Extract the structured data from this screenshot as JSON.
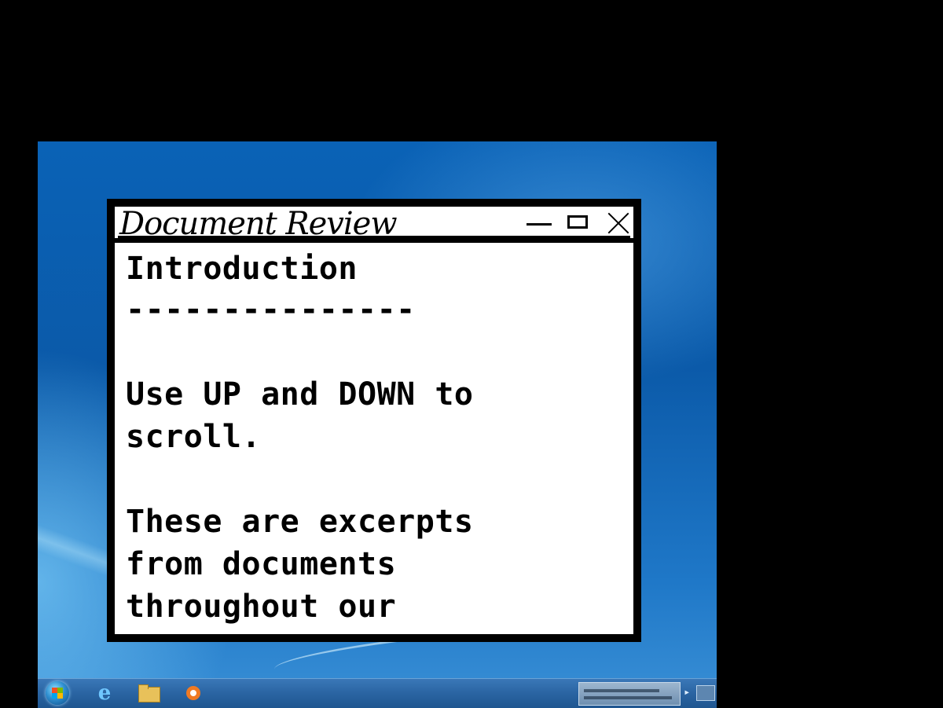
{
  "window": {
    "title": "Document Review",
    "controls": {
      "minimize_icon": "minimize-icon",
      "maximize_icon": "maximize-icon",
      "close_icon": "close-icon"
    }
  },
  "document": {
    "lines": [
      "Introduction",
      "---------------",
      "",
      "Use UP and DOWN to",
      "scroll.",
      "",
      "These are excerpts",
      "from documents",
      "throughout our"
    ]
  },
  "taskbar": {
    "icons": [
      "windows-start-icon",
      "internet-explorer-icon",
      "folder-icon",
      "media-player-icon"
    ],
    "ie_glyph": "e"
  },
  "colors": {
    "desktop_blue": "#0b5aa9",
    "window_border": "#000000",
    "window_background": "#ffffff",
    "taskbar": "#2a64a2"
  }
}
